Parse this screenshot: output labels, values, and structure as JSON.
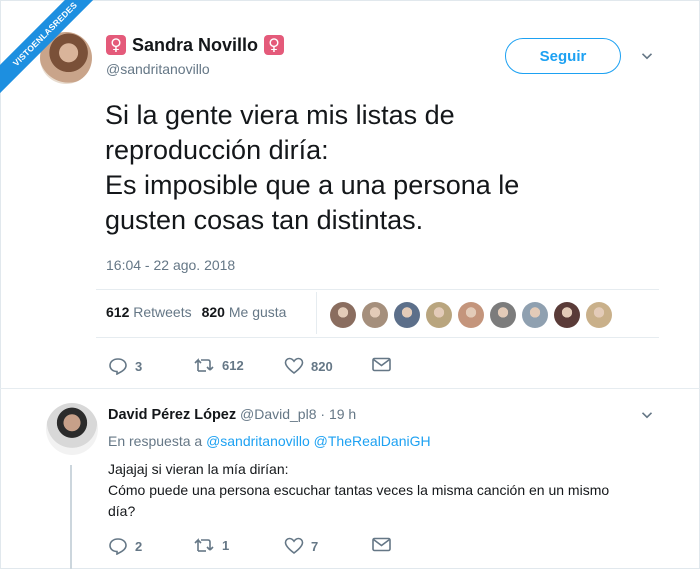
{
  "watermark": {
    "text": "VISTOENLASREDES"
  },
  "tweet": {
    "display_name": "Sandra Novillo",
    "emoji_left": "♀",
    "emoji_right": "♀",
    "handle": "@sandritanovillo",
    "follow_label": "Seguir",
    "text_lines": [
      "Si la gente viera mis listas de",
      "reproducción diría:",
      "Es imposible que a una persona le",
      "gusten cosas tan distintas."
    ],
    "timestamp": "16:04 - 22 ago. 2018",
    "retweets_count": "612",
    "retweets_label": "Retweets",
    "likes_count": "820",
    "likes_label": "Me gusta",
    "likers_colors": [
      "#8a6d5f",
      "#a58f7c",
      "#5c6f8a",
      "#b9a57e",
      "#c4957c",
      "#7c7c7c",
      "#8fa0b0",
      "#5a3b38",
      "#c9b08a"
    ],
    "actions": {
      "replies": "3",
      "retweets": "612",
      "likes": "820"
    }
  },
  "reply": {
    "display_name": "David Pérez López",
    "handle": "@David_pl8",
    "separator": "·",
    "time": "19 h",
    "in_reply_prefix": "En respuesta a",
    "mention_1": "@sandritanovillo",
    "mention_2": "@TheRealDaniGH",
    "text_line_1": "Jajajaj si vieran la mía dirían:",
    "text_line_2": "Cómo puede una persona escuchar tantas veces la misma canción en un mismo día?",
    "actions": {
      "replies": "2",
      "retweets": "1",
      "likes": "7"
    }
  },
  "colors": {
    "accent": "#1da1f2",
    "muted": "#657786",
    "text": "#14171a",
    "watermark": "#1d8fe0"
  }
}
